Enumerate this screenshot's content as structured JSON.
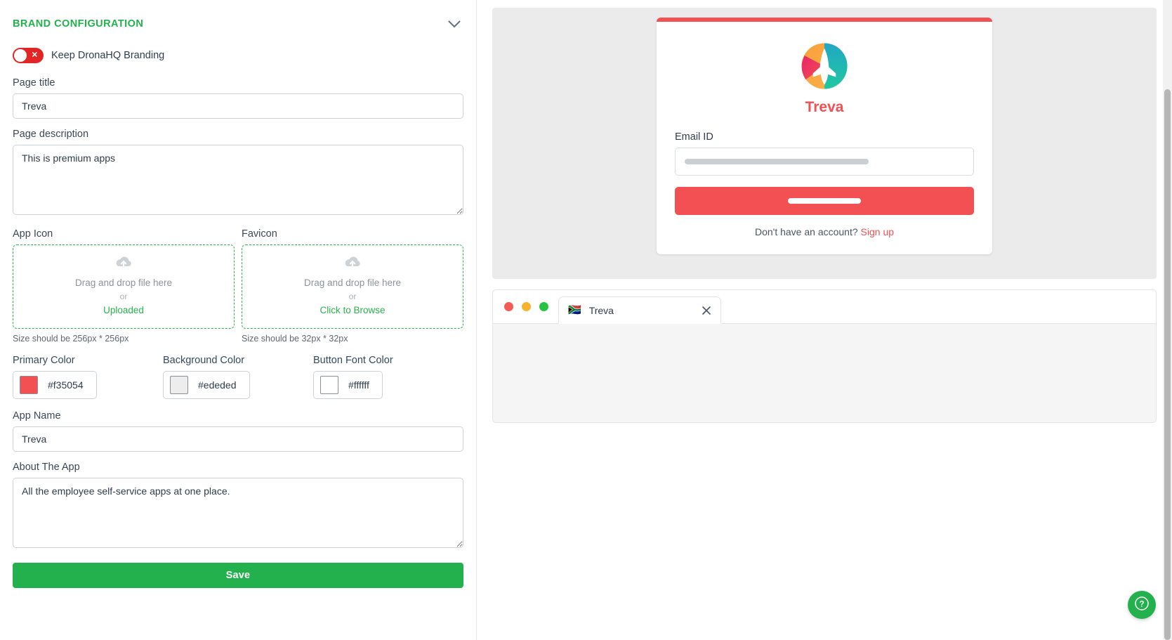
{
  "left_panel": {
    "section_title": "BRAND CONFIGURATION",
    "collapse_icon": "chevron-down-icon",
    "branding_toggle": {
      "label": "Keep DronaHQ Branding",
      "state": "off",
      "mark": "✕"
    },
    "fields": {
      "page_title": {
        "label": "Page title",
        "value": "Treva",
        "placeholder": "Page title"
      },
      "page_description": {
        "label": "Page description",
        "value": "This is premium apps",
        "placeholder": "Page description"
      },
      "app_name": {
        "label": "App Name",
        "value": "Treva",
        "placeholder": "App Name"
      },
      "about_the_app": {
        "label": "About The App",
        "value": "All the employee self-service apps at one place.",
        "placeholder": "About The App"
      }
    },
    "uploads": [
      {
        "label": "App Icon",
        "icon": "cloud-upload-icon",
        "drop_text": "Drag and drop file here",
        "or_text": "or",
        "action_text": "Uploaded",
        "size_hint": "Size should be 256px * 256px"
      },
      {
        "label": "Favicon",
        "icon": "cloud-upload-icon",
        "drop_text": "Drag and drop file here",
        "or_text": "or",
        "action_text": "Click to Browse",
        "size_hint": "Size should be 32px * 32px"
      }
    ],
    "colors": [
      {
        "label": "Primary Color",
        "value": "#f35054",
        "swatch": "#f35054"
      },
      {
        "label": "Background Color",
        "value": "#ededed",
        "swatch": "#ededed"
      },
      {
        "label": "Button Font Color",
        "value": "#ffffff",
        "swatch": "#ffffff"
      }
    ],
    "save_button": "Save"
  },
  "preview": {
    "login_card": {
      "accent_bar_color": "#f35054",
      "logo_icon": "treva-airplane-logo",
      "brand_name": "Treva",
      "email_label": "Email ID",
      "email_value": "",
      "submit_button_color": "#f35054",
      "footer_text": "Don't have an account?",
      "footer_link": "Sign up"
    },
    "browser": {
      "traffic_lights": [
        "red",
        "amber",
        "green"
      ],
      "tab": {
        "favicon": "🇿🇦",
        "title": "Treva",
        "close_icon": "close-icon"
      }
    }
  },
  "help_button": {
    "icon": "question-mark-icon",
    "glyph": "?",
    "color": "#22b14c"
  }
}
